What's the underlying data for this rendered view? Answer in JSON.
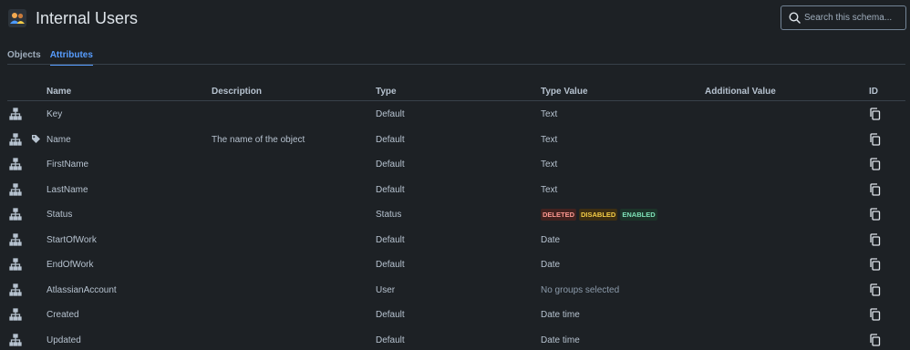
{
  "header": {
    "title": "Internal Users",
    "icon": "users-icon",
    "search_placeholder": "Search this schema..."
  },
  "tabs": [
    {
      "label": "Objects",
      "active": false
    },
    {
      "label": "Attributes",
      "active": true
    }
  ],
  "columns": {
    "name": "Name",
    "description": "Description",
    "type": "Type",
    "type_value": "Type Value",
    "additional_value": "Additional Value",
    "id": "ID"
  },
  "rows": [
    {
      "name": "Key",
      "description": "",
      "type": "Default",
      "type_value": "Text",
      "label_icon": false
    },
    {
      "name": "Name",
      "description": "The name of the object",
      "type": "Default",
      "type_value": "Text",
      "label_icon": true
    },
    {
      "name": "FirstName",
      "description": "",
      "type": "Default",
      "type_value": "Text",
      "label_icon": false
    },
    {
      "name": "LastName",
      "description": "",
      "type": "Default",
      "type_value": "Text",
      "label_icon": false
    },
    {
      "name": "Status",
      "description": "",
      "type": "Status",
      "type_value": "",
      "statuses": [
        "DELETED",
        "DISABLED",
        "ENABLED"
      ],
      "label_icon": false
    },
    {
      "name": "StartOfWork",
      "description": "",
      "type": "Default",
      "type_value": "Date",
      "label_icon": false
    },
    {
      "name": "EndOfWork",
      "description": "",
      "type": "Default",
      "type_value": "Date",
      "label_icon": false
    },
    {
      "name": "AtlassianAccount",
      "description": "",
      "type": "User",
      "type_value": "No groups selected",
      "label_icon": false
    },
    {
      "name": "Created",
      "description": "",
      "type": "Default",
      "type_value": "Date time",
      "label_icon": false
    },
    {
      "name": "Updated",
      "description": "",
      "type": "Default",
      "type_value": "Date time",
      "label_icon": false
    }
  ],
  "colors": {
    "background": "#1d2125",
    "accent": "#579dff",
    "deleted": "#fd9891",
    "disabled": "#f5cd47",
    "enabled": "#7ee2b8"
  }
}
